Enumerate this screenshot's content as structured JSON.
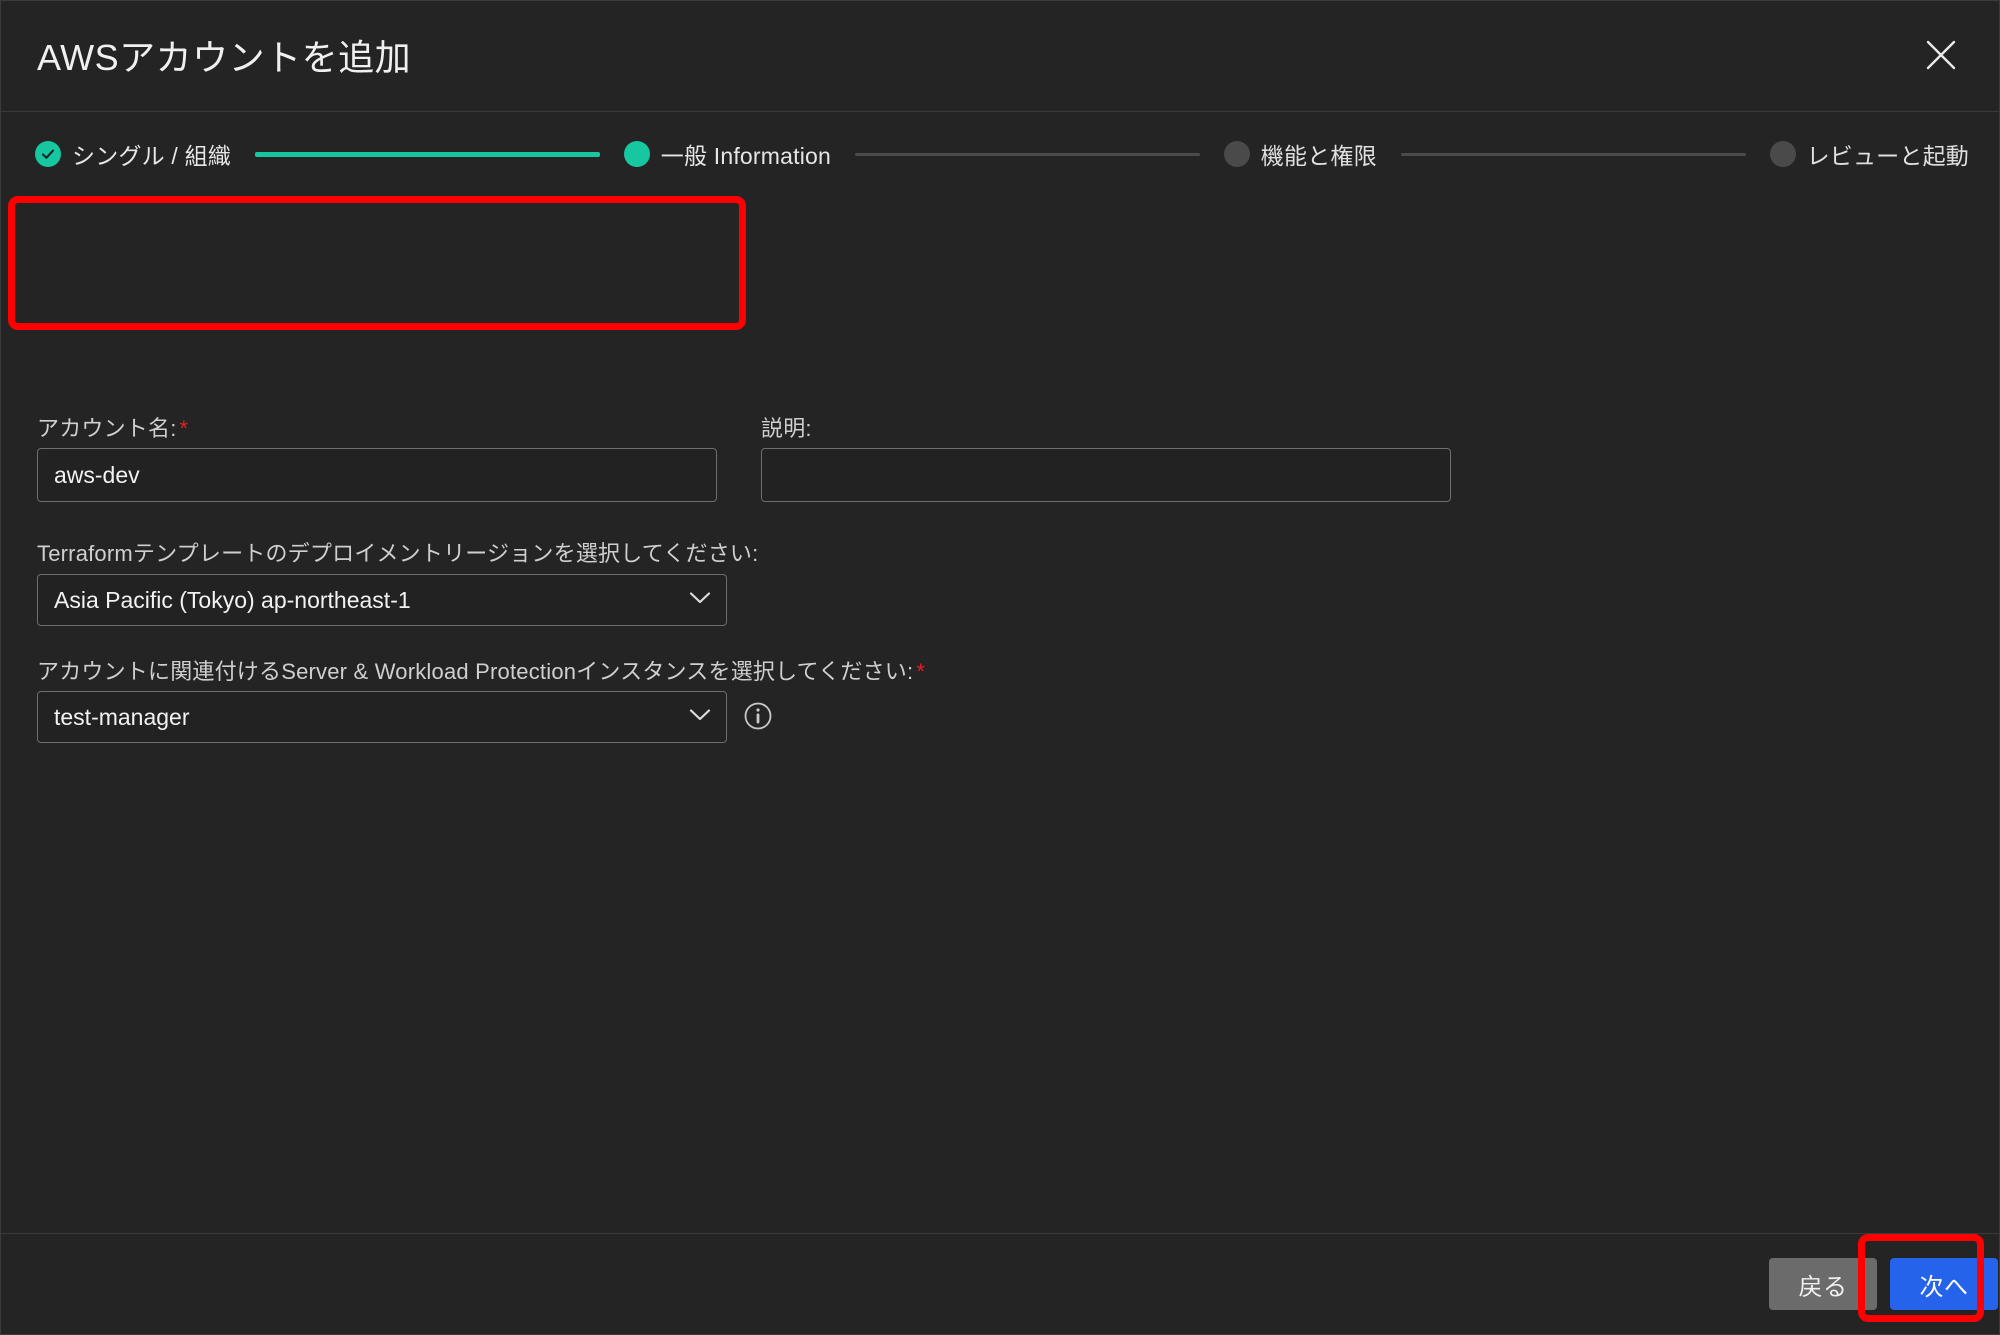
{
  "dialog": {
    "title": "AWSアカウントを追加",
    "close_icon": "close-icon"
  },
  "stepper": {
    "steps": [
      {
        "label": "シングル / 組織",
        "state": "done"
      },
      {
        "label": "一般 Information",
        "state": "active"
      },
      {
        "label": "機能と権限",
        "state": "todo"
      },
      {
        "label": "レビューと起動",
        "state": "todo"
      }
    ],
    "colors": {
      "active": "#17c7a0",
      "inactive": "#4a4a4a",
      "connector_filled": "#17c7a0",
      "connector_empty": "#4b4b4b"
    }
  },
  "form": {
    "account_name": {
      "label": "アカウント名:",
      "required_marker": "*",
      "value": "aws-dev",
      "placeholder": ""
    },
    "description": {
      "label": "説明:",
      "value": "",
      "placeholder": ""
    },
    "region": {
      "label": "Terraformテンプレートのデプロイメントリージョンを選択してください:",
      "value": "Asia Pacific (Tokyo) ap-northeast-1"
    },
    "instance": {
      "label": "アカウントに関連付けるServer & Workload Protectionインスタンスを選択してください:",
      "required_marker": "*",
      "value": "test-manager",
      "info_icon": "info-icon"
    }
  },
  "footer": {
    "back_label": "戻る",
    "next_label": "次へ",
    "next_color": "#2563eb",
    "back_color": "#6b6b6b"
  },
  "annotations": {
    "highlight_color": "#fe0000",
    "boxes": [
      {
        "name": "account-name-field-highlight"
      },
      {
        "name": "next-button-highlight"
      }
    ]
  }
}
